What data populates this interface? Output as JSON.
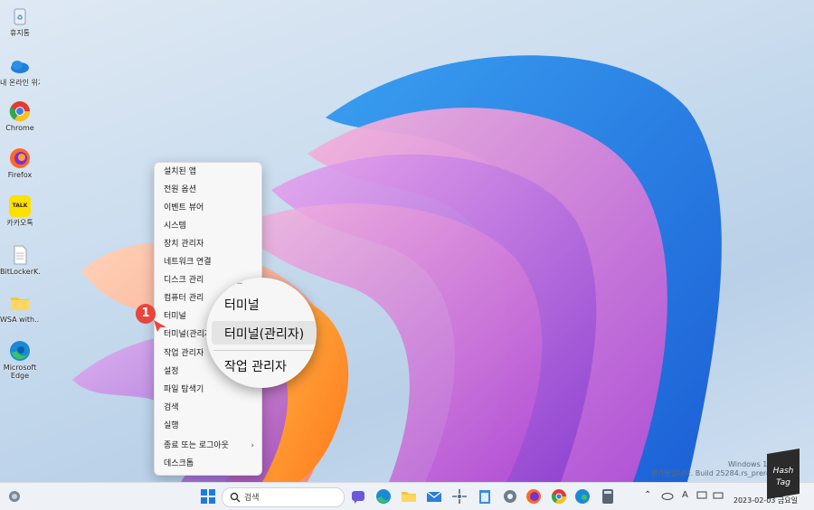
{
  "desktop": {
    "icons": [
      {
        "name": "recycle-bin",
        "label": "휴지통"
      },
      {
        "name": "onedrive",
        "label": "내 온라인 위치"
      },
      {
        "name": "chrome",
        "label": "Chrome"
      },
      {
        "name": "firefox",
        "label": "Firefox"
      },
      {
        "name": "kakaotalk",
        "label": "카카오톡",
        "badge": "TALK"
      },
      {
        "name": "file",
        "label": "BitLockerK..."
      },
      {
        "name": "folder",
        "label": "WSA with..."
      },
      {
        "name": "edge",
        "label": "Microsoft Edge"
      }
    ]
  },
  "context_menu": {
    "items": [
      "설치된 앱",
      "전원 옵션",
      "이벤트 뷰어",
      "시스템",
      "장치 관리자",
      "네트워크 연결",
      "디스크 관리",
      "컴퓨터 관리",
      "터미널",
      "터미널(관리자)",
      "작업 관리자",
      "설정",
      "파일 탐색기",
      "검색",
      "실행",
      "종료 또는 로그아웃",
      "데스크톱"
    ],
    "submenu_chevron": "›"
  },
  "magnifier": {
    "items": [
      "터미널",
      "터미널(관리자)",
      "작업 관리자"
    ],
    "top_fragment": "ㅣ ㄴ"
  },
  "step_badge": "1",
  "watermark": {
    "line1": "Windows 11 Pr",
    "line2": "평가본입니다. Build 25284.rs_prerelea"
  },
  "taskbar": {
    "search_placeholder": "검색",
    "tray_text": "A",
    "clock_time": "오후",
    "clock_date": "2023-02-03 금요일"
  },
  "hashtag": {
    "line1": "Hash",
    "line2": "Tag"
  },
  "colors": {
    "taskbar": "#eef1f5",
    "badge": "#e8453c",
    "menu": "#f7f7f7"
  }
}
